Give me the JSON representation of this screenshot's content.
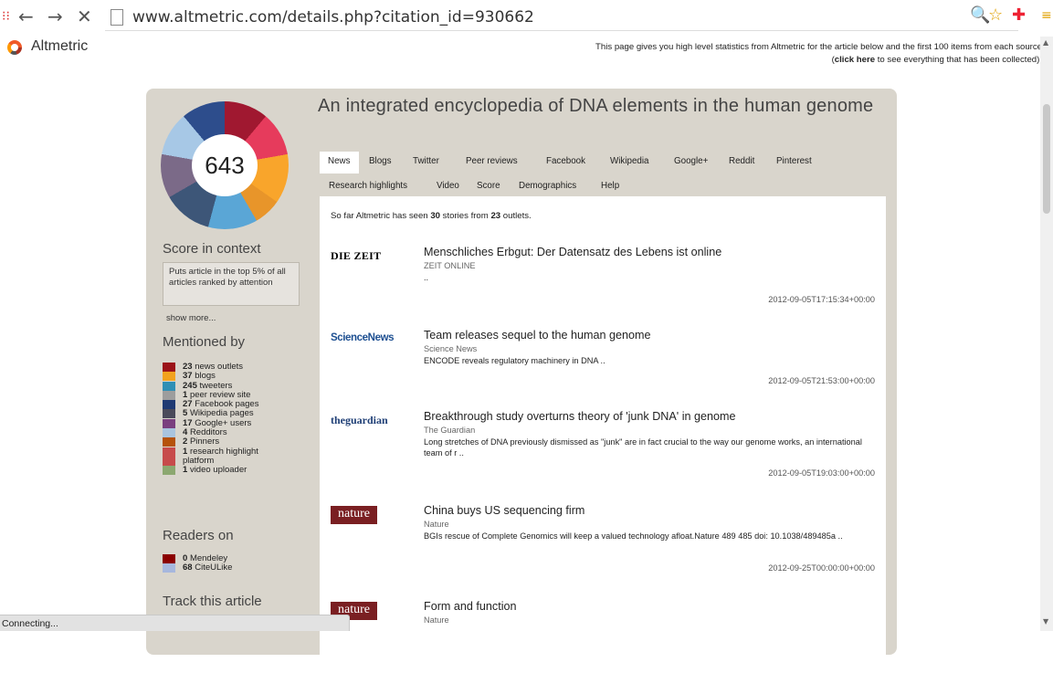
{
  "browser": {
    "back_icon": "←",
    "forward_icon": "→",
    "close_icon": "✕",
    "url": "www.altmetric.com/details.php?citation_id=930662",
    "zoom_icon": "🔍",
    "star_icon": "☆"
  },
  "header": {
    "brand": "Altmetric",
    "intro_line1": "This page gives you high level statistics from Altmetric for the article below and the first 100 items from each source",
    "intro_line2_prefix": "(",
    "intro_link": "click here",
    "intro_line2_suffix": " to see everything that has been collected)."
  },
  "article": {
    "title": "An integrated encyclopedia of DNA elements in the human genome",
    "score": "643"
  },
  "sidebar": {
    "score_context_title": "Score in context",
    "score_context_text": "Puts article in the top 5% of all articles ranked by attention",
    "show_more": "show more...",
    "mentioned_title": "Mentioned by",
    "mentions": [
      {
        "count": "23",
        "label": "news outlets",
        "color": "#9b1218"
      },
      {
        "count": "37",
        "label": "blogs",
        "color": "#f2a21e"
      },
      {
        "count": "245",
        "label": "tweeters",
        "color": "#2e8fb5"
      },
      {
        "count": "1",
        "label": "peer review site",
        "color": "#9d9d9d"
      },
      {
        "count": "27",
        "label": "Facebook pages",
        "color": "#1f3a73"
      },
      {
        "count": "5",
        "label": "Wikipedia pages",
        "color": "#4a4a5a"
      },
      {
        "count": "17",
        "label": "Google+ users",
        "color": "#7a3f7f"
      },
      {
        "count": "4",
        "label": "Redditors",
        "color": "#a9c4de"
      },
      {
        "count": "2",
        "label": "Pinners",
        "color": "#b5520a"
      },
      {
        "count": "1",
        "label": "research highlight",
        "label2": "platform",
        "color": "#c74b4b"
      },
      {
        "count": "1",
        "label": "video uploader",
        "color": "#8ca870"
      }
    ],
    "readers_title": "Readers on",
    "readers": [
      {
        "count": "0",
        "label": "Mendeley",
        "color": "#8b0000"
      },
      {
        "count": "68",
        "label": "CiteULike",
        "color": "#a7b7dd"
      }
    ],
    "track_title": "Track this article"
  },
  "tabs": {
    "row1": [
      "News",
      "Blogs",
      "Twitter",
      "Peer reviews",
      "Facebook",
      "Wikipedia",
      "Google+",
      "Reddit",
      "Pinterest"
    ],
    "row2": [
      "Research highlights",
      "Video",
      "Score",
      "Demographics",
      "Help"
    ]
  },
  "news": {
    "intro_prefix": "So far Altmetric has seen ",
    "story_count": "30",
    "intro_mid": " stories from ",
    "outlet_count": "23",
    "intro_suffix": " outlets.",
    "stories": [
      {
        "logo": "DIE ZEIT",
        "title": "Menschliches Erbgut: Der Datensatz des Lebens ist online",
        "source": "ZEIT ONLINE",
        "summary": "..",
        "date": "2012-09-05T17:15:34+00:00"
      },
      {
        "logo": "ScienceNews",
        "title": "Team releases sequel to the human genome",
        "source": "Science News",
        "summary": "ENCODE reveals regulatory machinery in DNA ..",
        "date": "2012-09-05T21:53:00+00:00"
      },
      {
        "logo": "theguardian",
        "title": "Breakthrough study overturns theory of 'junk DNA' in genome",
        "source": "The Guardian",
        "summary": "Long stretches of DNA previously dismissed as \"junk\" are in fact crucial to the way our genome works, an international team of r ..",
        "date": "2012-09-05T19:03:00+00:00"
      },
      {
        "logo": "nature",
        "title": "China buys US sequencing firm",
        "source": "Nature",
        "summary": "BGIs rescue of Complete Genomics will keep a valued technology afloat.Nature 489 485 doi: 10.1038/489485a ..",
        "date": "2012-09-25T00:00:00+00:00"
      },
      {
        "logo": "nature",
        "title": "Form and function",
        "source": "Nature",
        "summary": "",
        "date": ""
      }
    ]
  },
  "status": "Connecting..."
}
